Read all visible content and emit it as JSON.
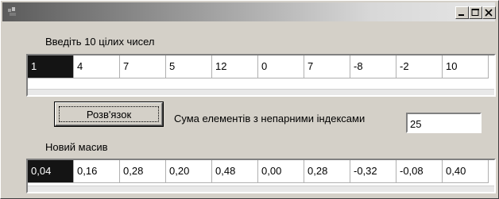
{
  "window": {
    "title": ""
  },
  "input_section": {
    "label": "Введіть 10 цілих чисел",
    "values": [
      "1",
      "4",
      "7",
      "5",
      "12",
      "0",
      "7",
      "-8",
      "-2",
      "10"
    ]
  },
  "solve_button": {
    "label": "Розв'язок"
  },
  "sum": {
    "label": "Сума елементів з непарними індексами",
    "value": "25"
  },
  "output_section": {
    "label": "Новий масив",
    "values": [
      "0,04",
      "0,16",
      "0,28",
      "0,20",
      "0,48",
      "0,00",
      "0,28",
      "-0,32",
      "-0,08",
      "0,40"
    ]
  },
  "colors": {
    "selected_cell": "#141414",
    "title_gradient_start": "#5b5b5b"
  },
  "icons": [
    "app-icon",
    "minimize-icon",
    "maximize-icon",
    "close-icon"
  ]
}
